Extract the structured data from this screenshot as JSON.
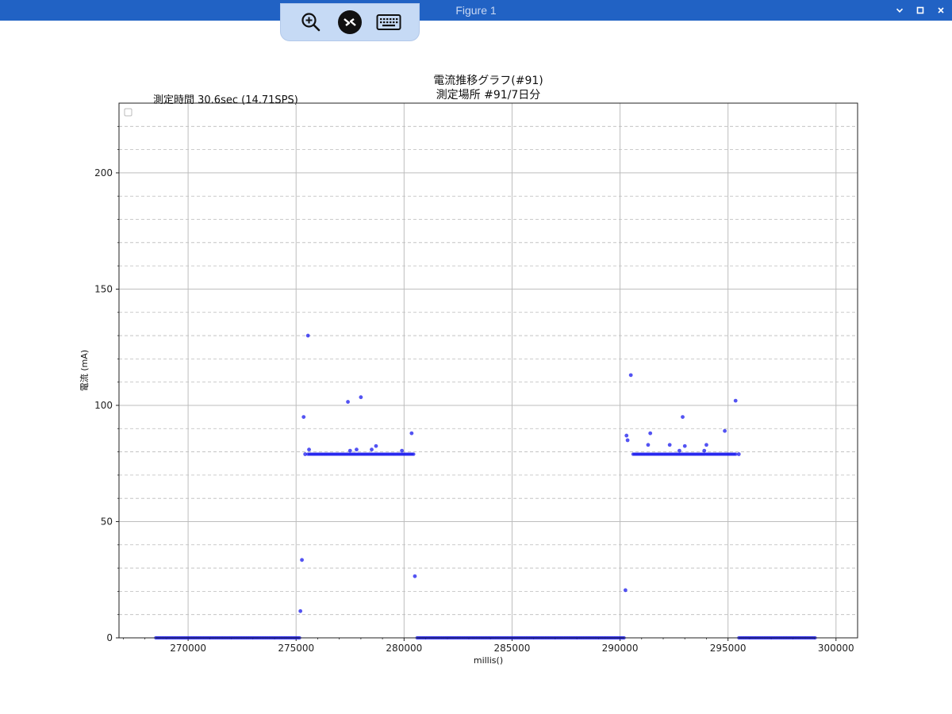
{
  "window": {
    "title": "Figure 1",
    "titlebar_color": "#2162c4",
    "controls": [
      "chevron-down-icon",
      "maximize-icon",
      "close-icon"
    ]
  },
  "toolbar": {
    "items": [
      "zoom-in-icon",
      "remote-connect-icon",
      "keyboard-icon"
    ]
  },
  "chart_data": {
    "type": "scatter",
    "title": "電流推移グラフ(#91)",
    "subtitle": "測定場所 #91/7日分",
    "annotation": "測定時間  30.6sec (14.71SPS)",
    "xlabel": "millis()",
    "ylabel": "電流 (mA)",
    "xlim": [
      266800,
      301000
    ],
    "ylim": [
      0,
      230
    ],
    "xticks": [
      270000,
      275000,
      280000,
      285000,
      290000,
      295000,
      300000
    ],
    "xtick_labels": [
      "270000",
      "275000",
      "280000",
      "285000",
      "290000",
      "295000",
      "300000"
    ],
    "yticks": [
      0,
      50,
      100,
      150,
      200
    ],
    "ytick_labels": [
      "0",
      "50",
      "100",
      "150",
      "200"
    ],
    "minor_y_gridlines": [
      10,
      20,
      30,
      40,
      60,
      70,
      80,
      90,
      110,
      120,
      130,
      140,
      160,
      170,
      180,
      190,
      210,
      220
    ],
    "grid": true,
    "legend": "top-left (empty)",
    "marker_color": "#1a1aee",
    "segments": [
      {
        "x_start": 268500,
        "x_end": 275200,
        "y": 0
      },
      {
        "x_start": 275550,
        "x_end": 280500,
        "y": 79
      },
      {
        "x_start": 280600,
        "x_end": 290200,
        "y": 0
      },
      {
        "x_start": 290600,
        "x_end": 295400,
        "y": 79
      },
      {
        "x_start": 295500,
        "x_end": 299100,
        "y": 0
      }
    ],
    "points": [
      {
        "x": 275200,
        "y": 11.5
      },
      {
        "x": 275270,
        "y": 33.5
      },
      {
        "x": 275350,
        "y": 95
      },
      {
        "x": 275420,
        "y": 79
      },
      {
        "x": 275550,
        "y": 130
      },
      {
        "x": 275600,
        "y": 81
      },
      {
        "x": 277400,
        "y": 101.5
      },
      {
        "x": 277500,
        "y": 80.5
      },
      {
        "x": 277800,
        "y": 81
      },
      {
        "x": 278000,
        "y": 103.5
      },
      {
        "x": 278500,
        "y": 81
      },
      {
        "x": 278700,
        "y": 82.5
      },
      {
        "x": 279900,
        "y": 80.5
      },
      {
        "x": 280350,
        "y": 88
      },
      {
        "x": 280500,
        "y": 26.5
      },
      {
        "x": 290250,
        "y": 20.5
      },
      {
        "x": 290300,
        "y": 87
      },
      {
        "x": 290350,
        "y": 85
      },
      {
        "x": 290500,
        "y": 113
      },
      {
        "x": 291300,
        "y": 83
      },
      {
        "x": 291400,
        "y": 88
      },
      {
        "x": 292300,
        "y": 83
      },
      {
        "x": 292750,
        "y": 80.5
      },
      {
        "x": 292900,
        "y": 95
      },
      {
        "x": 293000,
        "y": 82.5
      },
      {
        "x": 293900,
        "y": 80.5
      },
      {
        "x": 294000,
        "y": 83
      },
      {
        "x": 294850,
        "y": 89
      },
      {
        "x": 295350,
        "y": 102
      },
      {
        "x": 295500,
        "y": 79
      }
    ]
  }
}
